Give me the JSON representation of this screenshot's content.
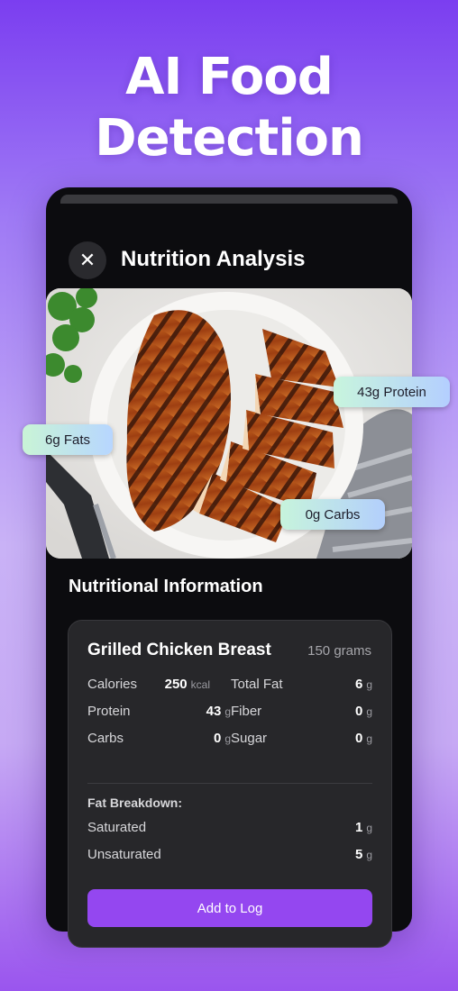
{
  "headline": [
    "AI Food",
    "Detection"
  ],
  "screen": {
    "close_icon": "close-icon",
    "title": "Nutrition Analysis",
    "section_title": "Nutritional Information"
  },
  "chips": {
    "protein": "43g Protein",
    "fats": "6g Fats",
    "carbs": "0g Carbs"
  },
  "card": {
    "food_name": "Grilled Chicken Breast",
    "weight": "150 grams",
    "rows": [
      {
        "label": "Calories",
        "value": "250",
        "unit": "kcal",
        "label2": "Total Fat",
        "value2": "6",
        "unit2": "g"
      },
      {
        "label": "Protein",
        "value": "43",
        "unit": "g",
        "label2": "Fiber",
        "value2": "0",
        "unit2": "g"
      },
      {
        "label": "Carbs",
        "value": "0",
        "unit": "g",
        "label2": "Sugar",
        "value2": "0",
        "unit2": "g"
      }
    ],
    "fat_breakdown_title": "Fat Breakdown:",
    "fat_rows": [
      {
        "label": "Saturated",
        "value": "1",
        "unit": "g"
      },
      {
        "label": "Unsaturated",
        "value": "5",
        "unit": "g"
      }
    ],
    "add_button": "Add to Log"
  },
  "colors": {
    "accent": "#9447f0",
    "card_bg": "#27272a",
    "phone_bg": "#0c0c0f"
  }
}
